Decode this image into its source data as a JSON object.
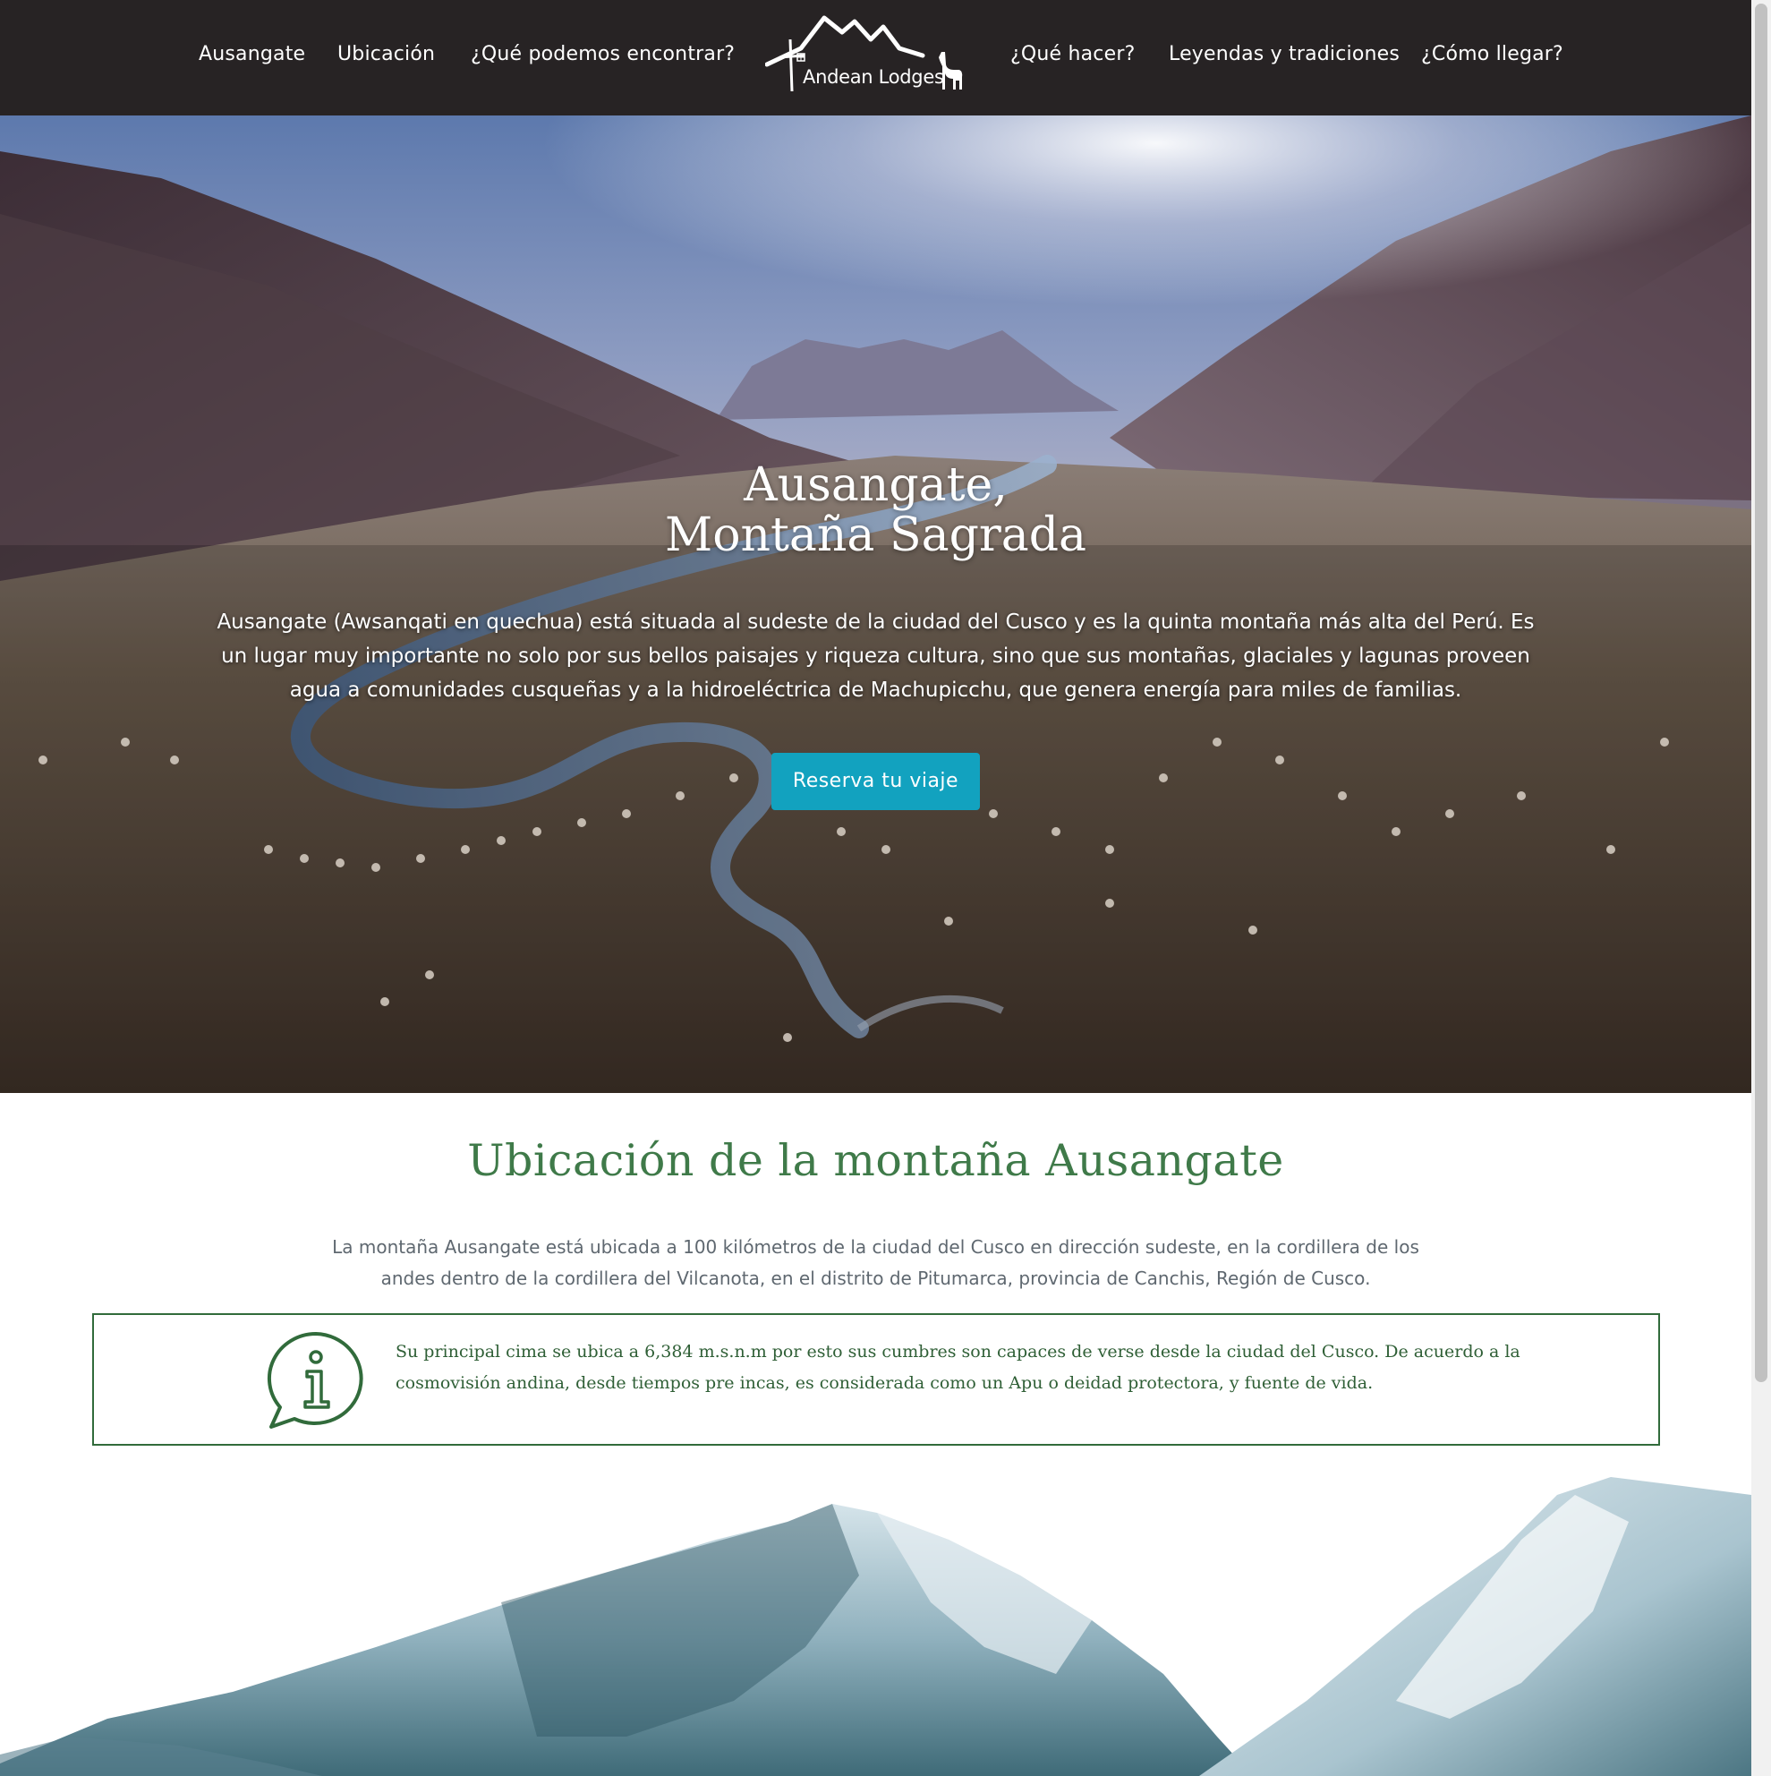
{
  "nav": {
    "left_links": [
      "Ausangate",
      "Ubicación",
      "¿Qué podemos encontrar?"
    ],
    "right_links": [
      "¿Qué hacer?",
      "Leyendas y tradiciones",
      "¿Cómo llegar?"
    ],
    "logo_text": "Andean Lodges"
  },
  "hero": {
    "title_line1": "Ausangate,",
    "title_line2": "Montaña Sagrada",
    "paragraph": "Ausangate (Awsanqati en quechua) está situada al sudeste de la ciudad del Cusco y es la quinta montaña más alta del Perú. Es un lugar muy importante no solo por sus bellos paisajes y riqueza cultura, sino que sus montañas, glaciales y lagunas proveen agua a comunidades cusqueñas y a la hidroeléctrica de Machupicchu, que genera energía para miles de familias.",
    "button_label": "Reserva tu viaje"
  },
  "location": {
    "title": "Ubicación de la montaña Ausangate",
    "paragraph": "La montaña Ausangate está ubicada a 100 kilómetros de la ciudad del Cusco en dirección sudeste, en la cordillera de los andes dentro de la cordillera del Vilcanota, en el distrito de Pitumarca, provincia de Canchis, Región de Cusco.",
    "info_text": "Su principal cima se ubica a 6,384 m.s.n.m por esto sus cumbres son capaces de verse desde la ciudad del Cusco. De acuerdo a la cosmovisión andina, desde tiempos pre incas, es considerada como un Apu o deidad protectora, y fuente de vida."
  },
  "colors": {
    "header_bg": "#272324",
    "button_bg": "#12a2bf",
    "title_green": "#3f7a49",
    "box_border": "#316b3b"
  },
  "icons": [
    "logo-mountains-icon",
    "llama-icon",
    "info-speech-bubble-icon"
  ]
}
